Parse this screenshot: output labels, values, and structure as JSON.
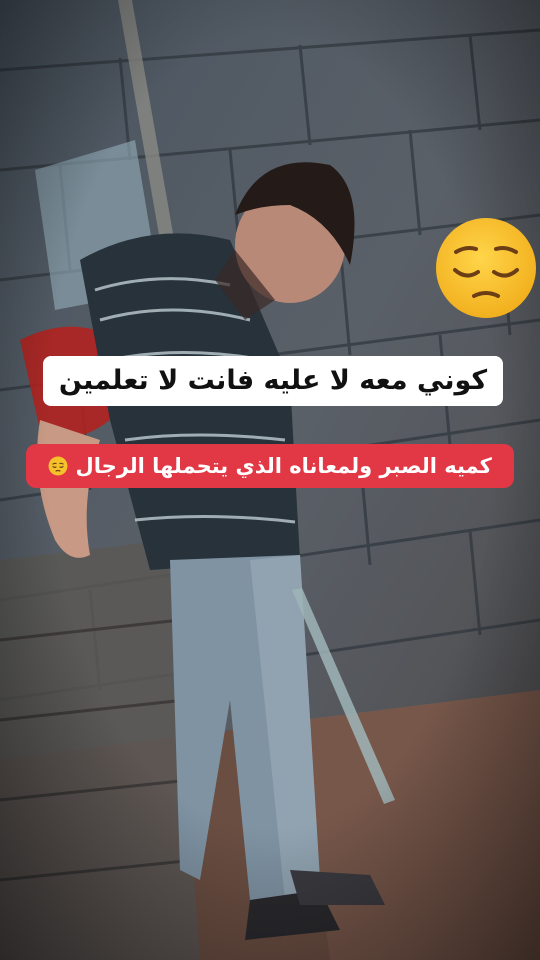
{
  "captions": {
    "line1": "كوني معه لا عليه فانت لا تعلمين",
    "line2": "كميه الصبر ولمعاناه الذي يتحملها الرجال"
  },
  "icons": {
    "big_emoji": "pensive-face-icon",
    "small_emoji": "pensive-face-icon"
  },
  "colors": {
    "caption_white_bg": "#ffffff",
    "caption_red_bg": "#e23744",
    "emoji_yellow": "#f6c22b"
  }
}
